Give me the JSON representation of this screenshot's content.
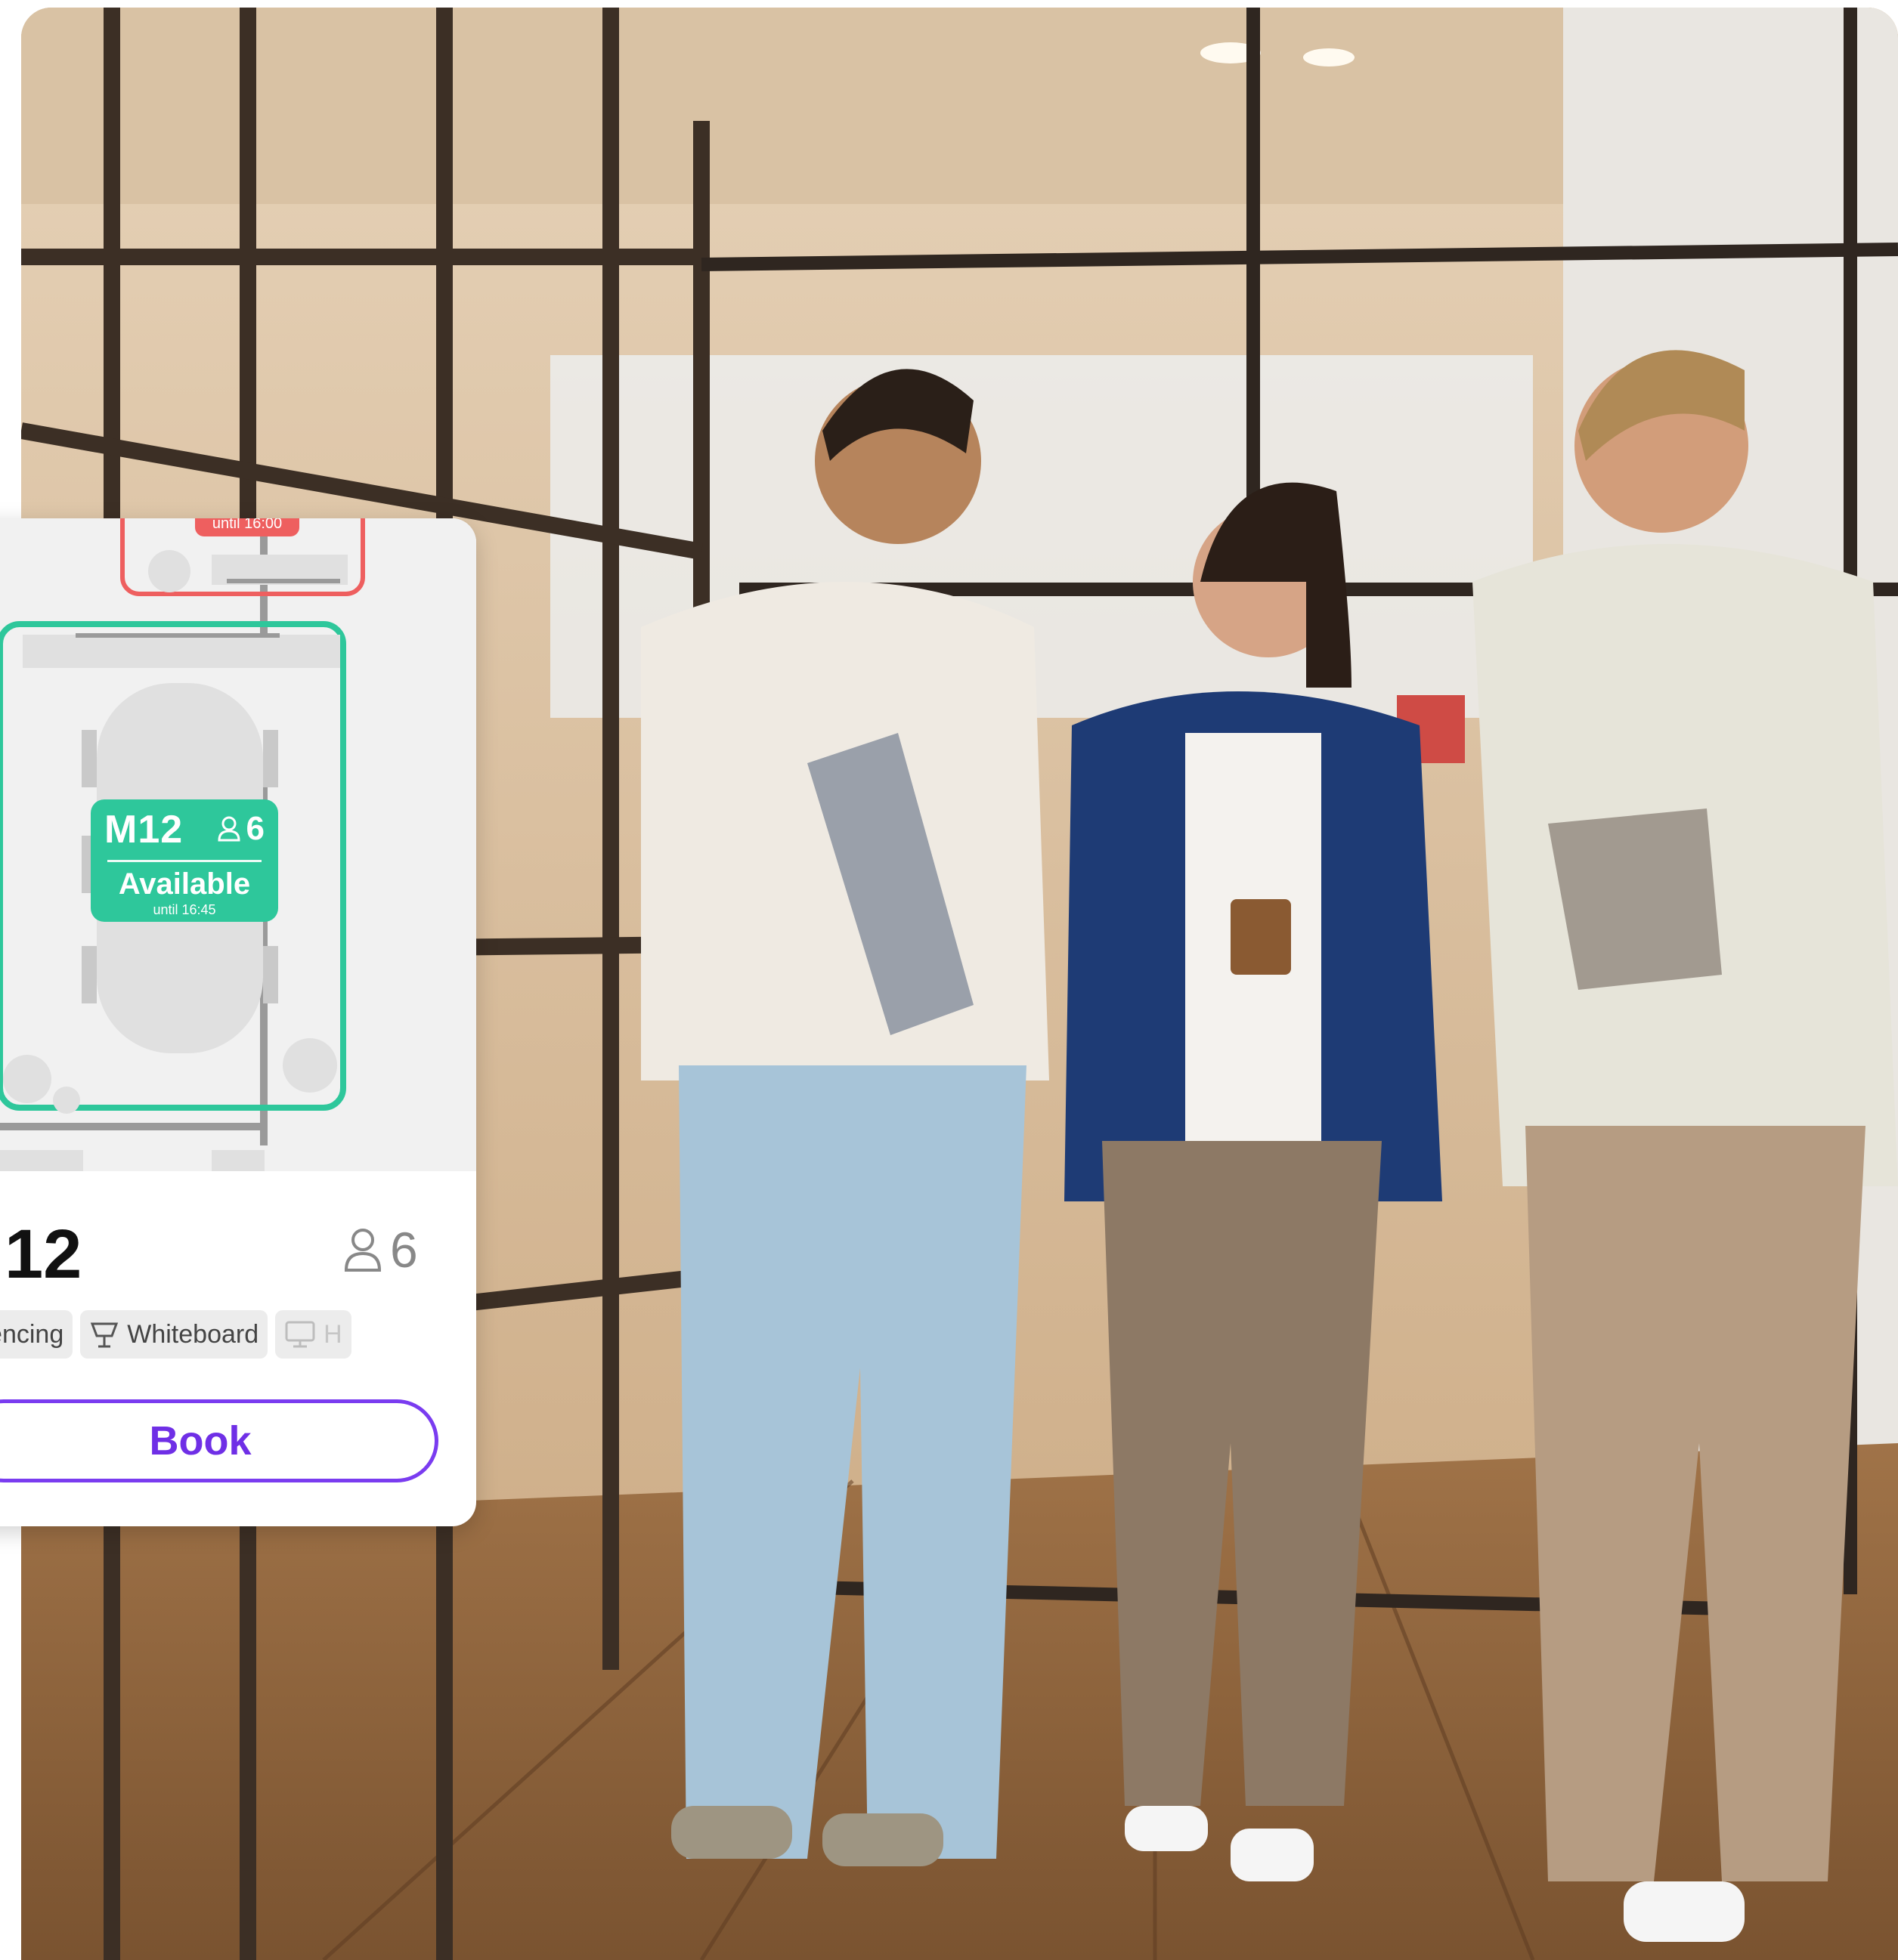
{
  "colors": {
    "available": "#2ec79b",
    "busy": "#ee5f5f",
    "accent": "#7a3cf0"
  },
  "room": {
    "id": "M12",
    "capacity": "6",
    "status": "Available",
    "until": "until 16:45",
    "neighbor_until": "until 16:00"
  },
  "card": {
    "title": "12",
    "capacity": "6",
    "amenities": [
      {
        "label": "Conferencing",
        "icon": "video-icon"
      },
      {
        "label": "Whiteboard",
        "icon": "whiteboard-icon"
      },
      {
        "label": "H",
        "icon": "monitor-icon"
      }
    ],
    "book_label": "Book"
  }
}
